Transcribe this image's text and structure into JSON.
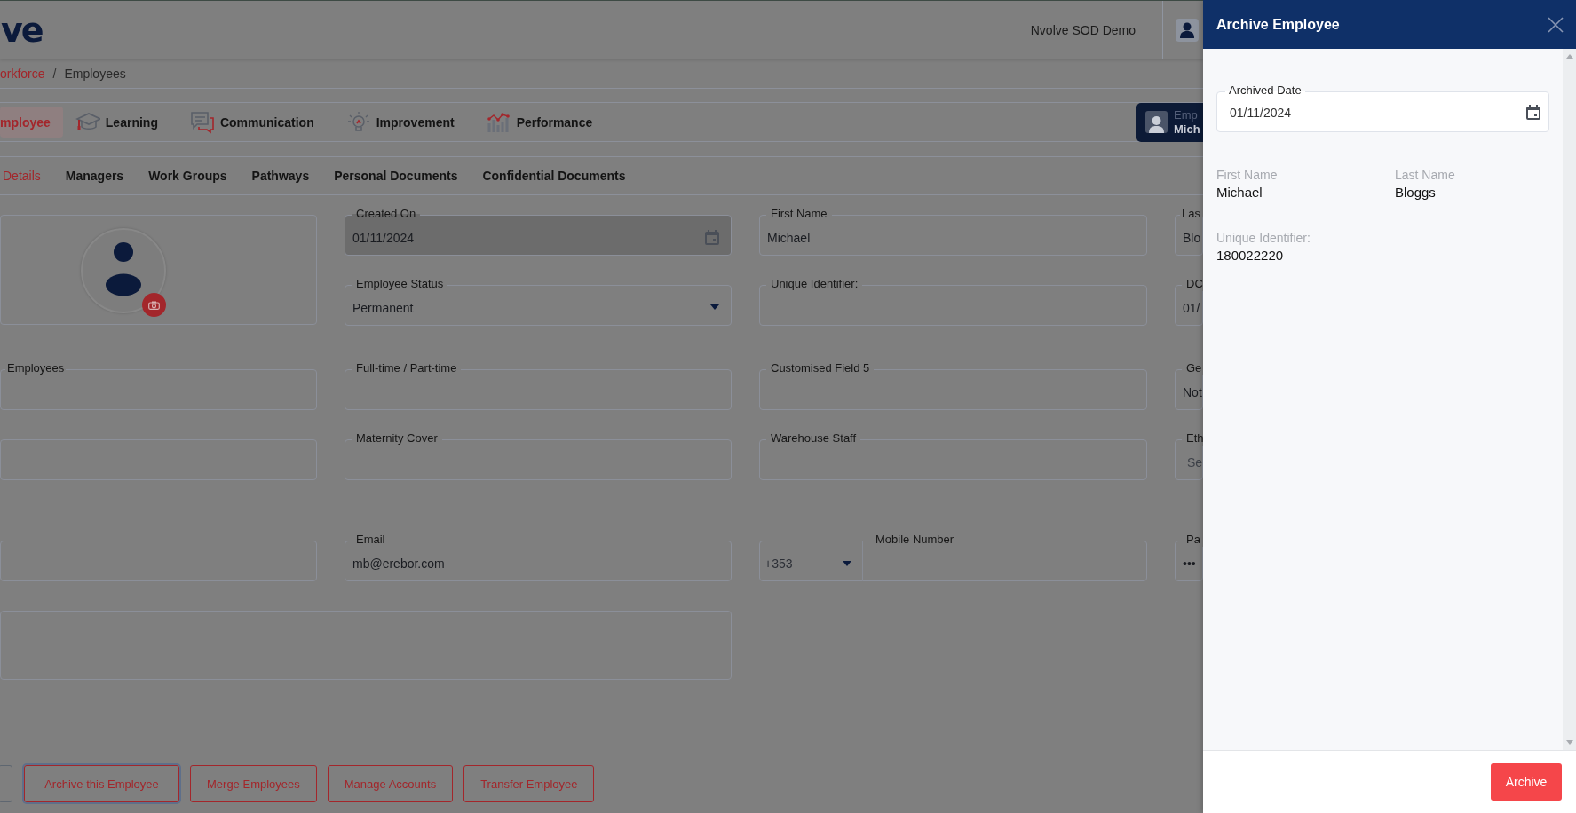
{
  "header": {
    "logo": "ve",
    "account": "Nvolve SOD Demo"
  },
  "breadcrumb": {
    "separator": "/",
    "items": [
      {
        "label": "orkforce",
        "kind": "link"
      },
      {
        "label": "Employees",
        "kind": "current"
      }
    ]
  },
  "modules": [
    {
      "label": "mployee",
      "selected": true
    },
    {
      "label": "Learning",
      "selected": false
    },
    {
      "label": "Communication",
      "selected": false
    },
    {
      "label": "Improvement",
      "selected": false
    },
    {
      "label": "Performance",
      "selected": false
    }
  ],
  "employee_badge": {
    "caption": "Emp",
    "name": "Mich"
  },
  "subtabs": [
    {
      "label": "Details",
      "selected": true
    },
    {
      "label": "Managers",
      "selected": false
    },
    {
      "label": "Work Groups",
      "selected": false
    },
    {
      "label": "Pathways",
      "selected": false
    },
    {
      "label": "Personal Documents",
      "selected": false
    },
    {
      "label": "Confidential Documents",
      "selected": false
    }
  ],
  "form": {
    "fields": [
      {
        "kind": "photo"
      },
      {
        "kind": "date",
        "label": "Created On",
        "value": "01/11/2024",
        "disabled": true
      },
      {
        "kind": "text",
        "label": "First Name",
        "value": "Michael",
        "disabled": false
      },
      {
        "kind": "text",
        "label": "Las",
        "value": "Blo",
        "disabled": false
      },
      {
        "kind": "select",
        "label": "Employee Status",
        "value": "Permanent",
        "disabled": false
      },
      {
        "kind": "text",
        "label": "Unique Identifier:",
        "disabled": false
      },
      {
        "kind": "text",
        "label": "DC",
        "value": "01/",
        "disabled": false
      },
      {
        "kind": "text",
        "label": "Employees",
        "disabled": false
      },
      {
        "kind": "text",
        "label": "Full-time / Part-time",
        "disabled": false
      },
      {
        "kind": "text",
        "label": "Customised Field 5",
        "disabled": false
      },
      {
        "kind": "text",
        "label": "Ge",
        "value": "Not",
        "disabled": false
      },
      {
        "kind": "text",
        "disabled": false
      },
      {
        "kind": "text",
        "label": "Maternity Cover",
        "disabled": false
      },
      {
        "kind": "text",
        "label": "Warehouse Staff",
        "disabled": false
      },
      {
        "kind": "text",
        "label": "Eth",
        "placeholder": "Se",
        "disabled": false
      },
      {
        "kind": "text",
        "disabled": false
      },
      {
        "kind": "text",
        "label": "Email",
        "value": "mb@erebor.com",
        "disabled": false
      },
      {
        "kind": "phone",
        "code": "+353",
        "label": "Mobile Number",
        "disabled": false
      },
      {
        "kind": "text",
        "label": "Pa",
        "value": "•••",
        "disabled": false
      },
      {
        "kind": "textarea",
        "disabled": false
      }
    ]
  },
  "actions": [
    {
      "kind": "cut",
      "focused": false
    },
    {
      "kind": "outline",
      "label": "Archive this Employee",
      "focused": true
    },
    {
      "kind": "outline",
      "label": "Merge Employees",
      "focused": false
    },
    {
      "kind": "outline",
      "label": "Manage Accounts",
      "focused": false
    },
    {
      "kind": "outline",
      "label": "Transfer Employee",
      "focused": false
    }
  ],
  "drawer": {
    "title": "Archive Employee",
    "archived_date": {
      "label": "Archived Date",
      "value": "01/11/2024"
    },
    "details": [
      {
        "label": "First Name",
        "value": "Michael"
      },
      {
        "label": "Last Name",
        "value": "Bloggs"
      },
      {
        "label": "Unique Identifier:",
        "value": "180022220"
      }
    ],
    "submit": "Archive"
  }
}
